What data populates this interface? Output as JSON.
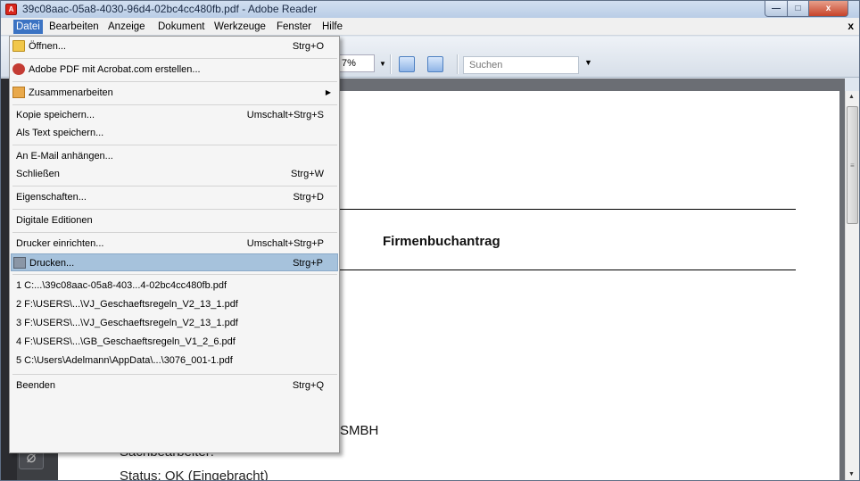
{
  "window": {
    "title": "39c08aac-05a8-4030-96d4-02bc4cc480fb.pdf - Adobe Reader",
    "controls": {
      "minimize": "—",
      "maximize": "□",
      "close": "x"
    }
  },
  "menubar": {
    "items": [
      "Datei",
      "Bearbeiten",
      "Anzeige",
      "Dokument",
      "Werkzeuge",
      "Fenster",
      "Hilfe"
    ],
    "close_doc": "x"
  },
  "toolbar": {
    "zoom": "7%",
    "search_placeholder": "Suchen"
  },
  "file_menu": {
    "open": {
      "label": "Öffnen...",
      "shortcut": "Strg+O"
    },
    "create_pdf": {
      "label": "Adobe PDF mit Acrobat.com erstellen..."
    },
    "collaborate": {
      "label": "Zusammenarbeiten"
    },
    "save_copy": {
      "label": "Kopie speichern...",
      "shortcut": "Umschalt+Strg+S"
    },
    "save_text": {
      "label": "Als Text speichern..."
    },
    "attach_email": {
      "label": "An E-Mail anhängen..."
    },
    "close": {
      "label": "Schließen",
      "shortcut": "Strg+W"
    },
    "properties": {
      "label": "Eigenschaften...",
      "shortcut": "Strg+D"
    },
    "digital_editions": {
      "label": "Digitale Editionen"
    },
    "print_setup": {
      "label": "Drucker einrichten...",
      "shortcut": "Umschalt+Strg+P"
    },
    "print": {
      "label": "Drucken...",
      "shortcut": "Strg+P"
    },
    "recent": [
      "1 C:...\\39c08aac-05a8-403...4-02bc4cc480fb.pdf",
      "2 F:\\USERS\\...\\VJ_Geschaeftsregeln_V2_13_1.pdf",
      "3 F:\\USERS\\...\\VJ_Geschaeftsregeln_V2_13_1.pdf",
      "4 F:\\USERS\\...\\GB_Geschaeftsregeln_V1_2_6.pdf",
      "5 C:\\Users\\Adelmann\\AppData\\...\\3076_001-1.pdf"
    ],
    "exit": {
      "label": "Beenden",
      "shortcut": "Strg+Q"
    }
  },
  "document": {
    "title": "Firmenbuchantrag",
    "frag_r": ")",
    "frag_smbh": "SMBH",
    "sachbearbeiter": "Sachbearbeiter:",
    "status": "Status: OK (Eingebracht)"
  }
}
